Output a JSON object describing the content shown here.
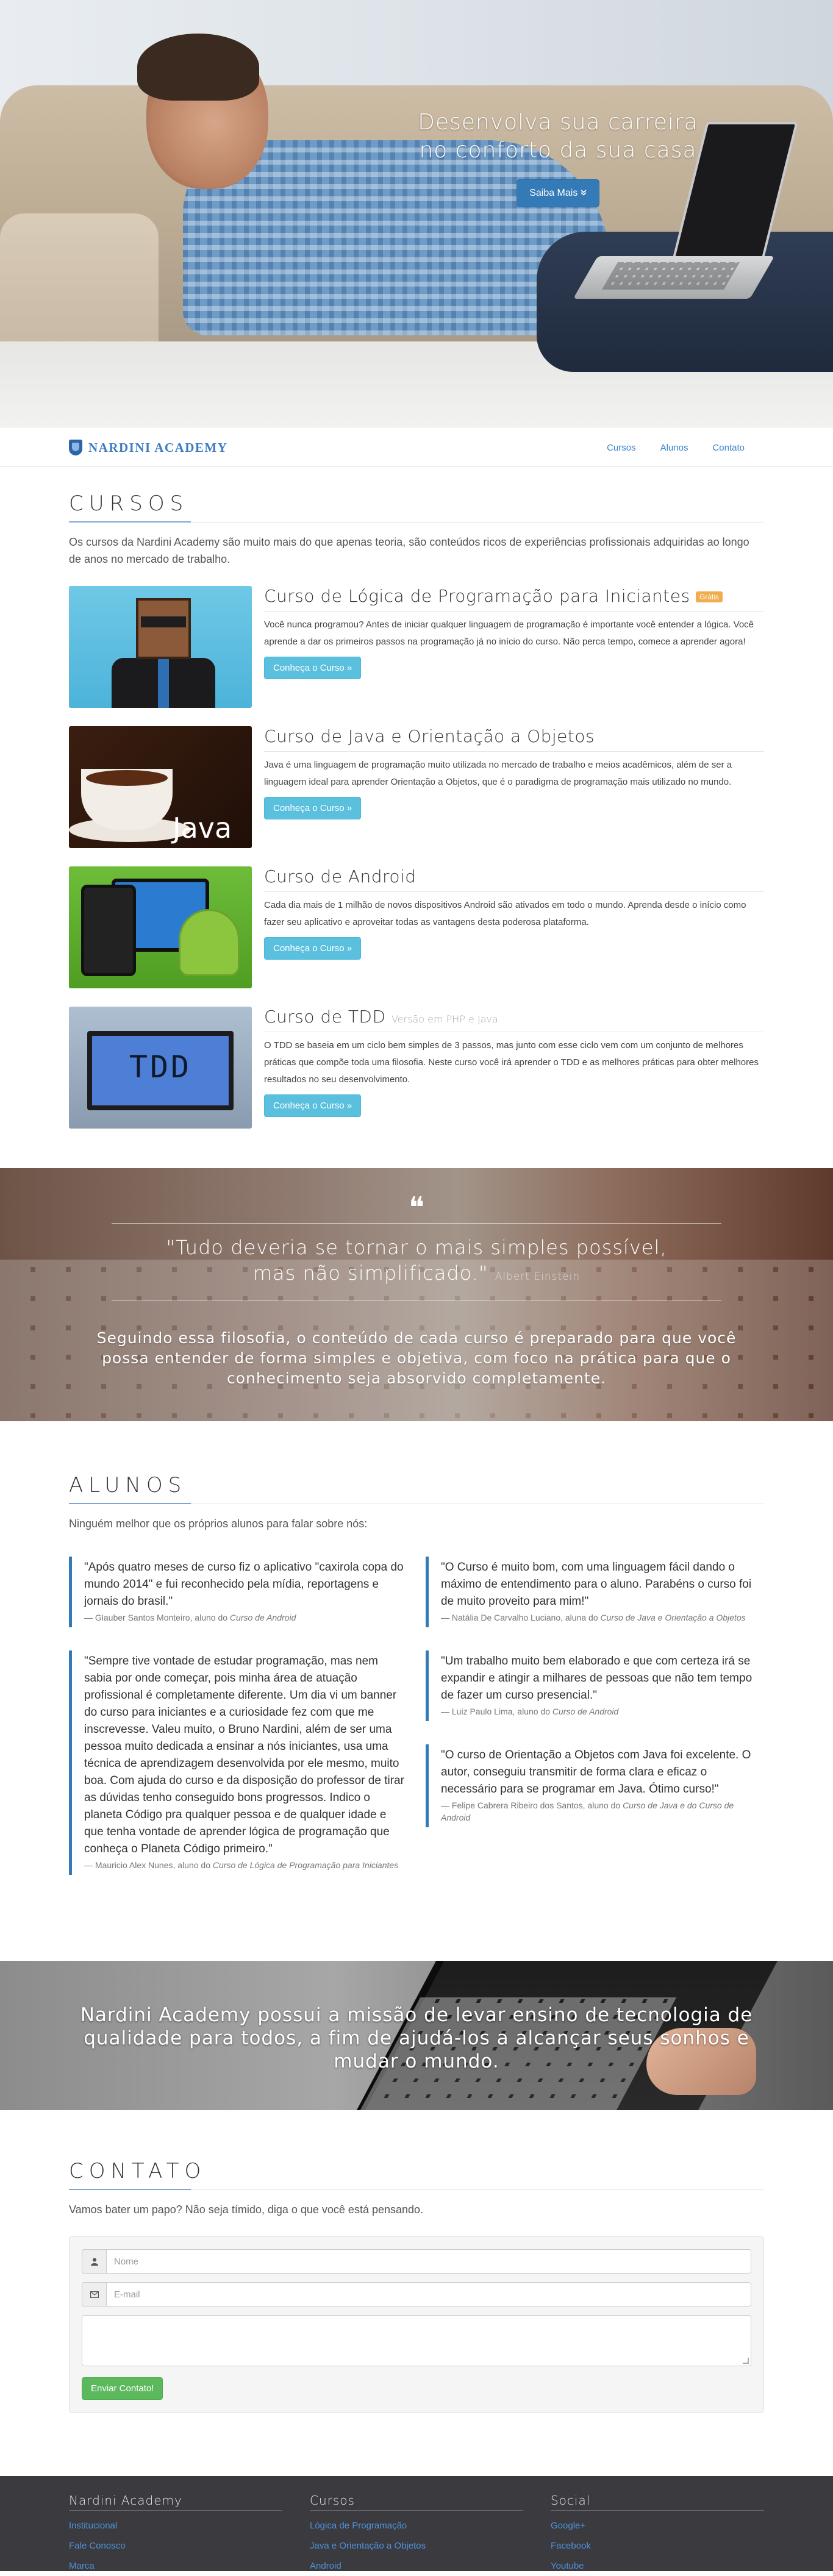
{
  "hero": {
    "headline_line1": "Desenvolva sua carreira",
    "headline_line2": "no conforto da sua casa",
    "cta_label": "Saiba Mais",
    "cta_icon": "double-chevron-down"
  },
  "navbar": {
    "brand": "NARDINI ACADEMY",
    "links": [
      "Cursos",
      "Alunos",
      "Contato"
    ]
  },
  "cursos": {
    "title": "CURSOS",
    "intro": "Os cursos da Nardini Academy são muito mais do que apenas teoria, são conteúdos ricos de experiências profissionais adquiridas ao longo de anos no mercado de trabalho.",
    "items": [
      {
        "title": "Curso de Lógica de Programação para Iniciantes",
        "badge": "Grátis",
        "description": "Você nunca programou? Antes de iniciar qualquer linguagem de programação é importante você entender a lógica. Você aprende a dar os primeiros passos na programação já no início do curso. Não perca tempo, comece a aprender agora!",
        "button": "Conheça o Curso »"
      },
      {
        "title": "Curso de Java e Orientação a Objetos",
        "description": "Java é uma linguagem de programação muito utilizada no mercado de trabalho e meios acadêmicos, além de ser a linguagem ideal para aprender Orientação a Objetos, que é o paradigma de programação mais utilizado no mundo.",
        "button": "Conheça o Curso »",
        "image_label": "Java"
      },
      {
        "title": "Curso de Android",
        "description": "Cada dia mais de 1 milhão de novos dispositivos Android são ativados em todo o mundo. Aprenda desde o início como fazer seu aplicativo e aproveitar todas as vantagens desta poderosa plataforma.",
        "button": "Conheça o Curso »"
      },
      {
        "title": "Curso de TDD",
        "subtitle": "Versão em PHP e Java",
        "description": "O TDD se baseia em um ciclo bem simples de 3 passos, mas junto com esse ciclo vem com um conjunto de melhores práticas que compõe toda uma filosofia. Neste curso você irá aprender o TDD e as melhores práticas para obter melhores resultados no seu desenvolvimento.",
        "button": "Conheça o Curso »",
        "image_label": "TDD"
      }
    ]
  },
  "quote": {
    "mark": "❝",
    "line1": "\"Tudo deveria se tornar o mais simples possível,",
    "line2": "mas não simplificado.\"",
    "author": "Albert Einstein",
    "philosophy": "Seguindo essa filosofia, o conteúdo de cada curso é preparado para que você possa entender de forma simples e objetiva, com foco na prática para que o conhecimento seja absorvido completamente."
  },
  "alunos": {
    "title": "ALUNOS",
    "intro": "Ninguém melhor que os próprios alunos para falar sobre nós:",
    "left": [
      {
        "text": "\"Após quatro meses de curso fiz o aplicativo \"caxirola copa do mundo 2014\" e fui reconhecido pela mídia, reportagens e jornais do brasil.\"",
        "author": "— Glauber Santos Monteiro, aluno do",
        "course": "Curso de Android"
      },
      {
        "text": "\"Sempre tive vontade de estudar programação, mas nem sabia por onde começar, pois minha área de atuação profissional é completamente diferente. Um dia vi um banner do curso para iniciantes e a curiosidade fez com que me inscrevesse. Valeu muito, o Bruno Nardini, além de ser uma pessoa muito dedicada a ensinar a nós iniciantes, usa uma técnica de aprendizagem desenvolvida por ele mesmo, muito boa. Com ajuda do curso e da disposição do professor de tirar as dúvidas tenho conseguido bons progressos. Indico o planeta Código pra qualquer pessoa e de qualquer idade e que tenha vontade de aprender lógica de programação que conheça o Planeta Código primeiro.\"",
        "author": "— Mauricio Alex Nunes, aluno do",
        "course": "Curso de Lógica de Programação para Iniciantes"
      }
    ],
    "right": [
      {
        "text": "\"O Curso é muito bom, com uma linguagem fácil dando o máximo de entendimento para o aluno. Parabéns o curso foi de muito proveito para mim!\"",
        "author": "— Natália De Carvalho Luciano, aluna do",
        "course": "Curso de Java e Orientação a Objetos"
      },
      {
        "text": "\"Um trabalho muito bem elaborado e que com certeza irá se expandir e atingir a milhares de pessoas que não tem tempo de fazer um curso presencial.\"",
        "author": "— Luiz Paulo Lima, aluno do",
        "course": "Curso de Android"
      },
      {
        "text": "\"O curso de Orientação a Objetos com Java foi excelente. O autor, conseguiu transmitir de forma clara e eficaz o necessário para se programar em Java. Ótimo curso!\"",
        "author": "— Felipe Cabrera Ribeiro dos Santos, aluno do",
        "course": "Curso de Java e do Curso de Android"
      }
    ]
  },
  "mission": {
    "text": "Nardini Academy possui a missão de levar ensino de tecnologia de qualidade para todos, a fim de ajudá-los a alcançar seus sonhos e mudar o mundo."
  },
  "contato": {
    "title": "CONTATO",
    "intro": "Vamos bater um papo? Não seja tímido, diga o que você está pensando.",
    "name_placeholder": "Nome",
    "email_placeholder": "E-mail",
    "submit": "Enviar Contato!"
  },
  "footer": {
    "col1": {
      "title": "Nardini Academy",
      "links": [
        "Institucional",
        "Fale Conosco",
        "Marca"
      ]
    },
    "col2": {
      "title": "Cursos",
      "links": [
        "Lógica de Programação",
        "Java e Orientação a Objetos",
        "Android"
      ]
    },
    "col3": {
      "title": "Social",
      "links": [
        "Google+",
        "Facebook",
        "Youtube"
      ]
    }
  },
  "colors": {
    "primary": "#337ab7",
    "info": "#5bc0de",
    "success": "#5cb85c",
    "badge": "#f0ad4e",
    "footer_bg": "#3a3a3f"
  }
}
